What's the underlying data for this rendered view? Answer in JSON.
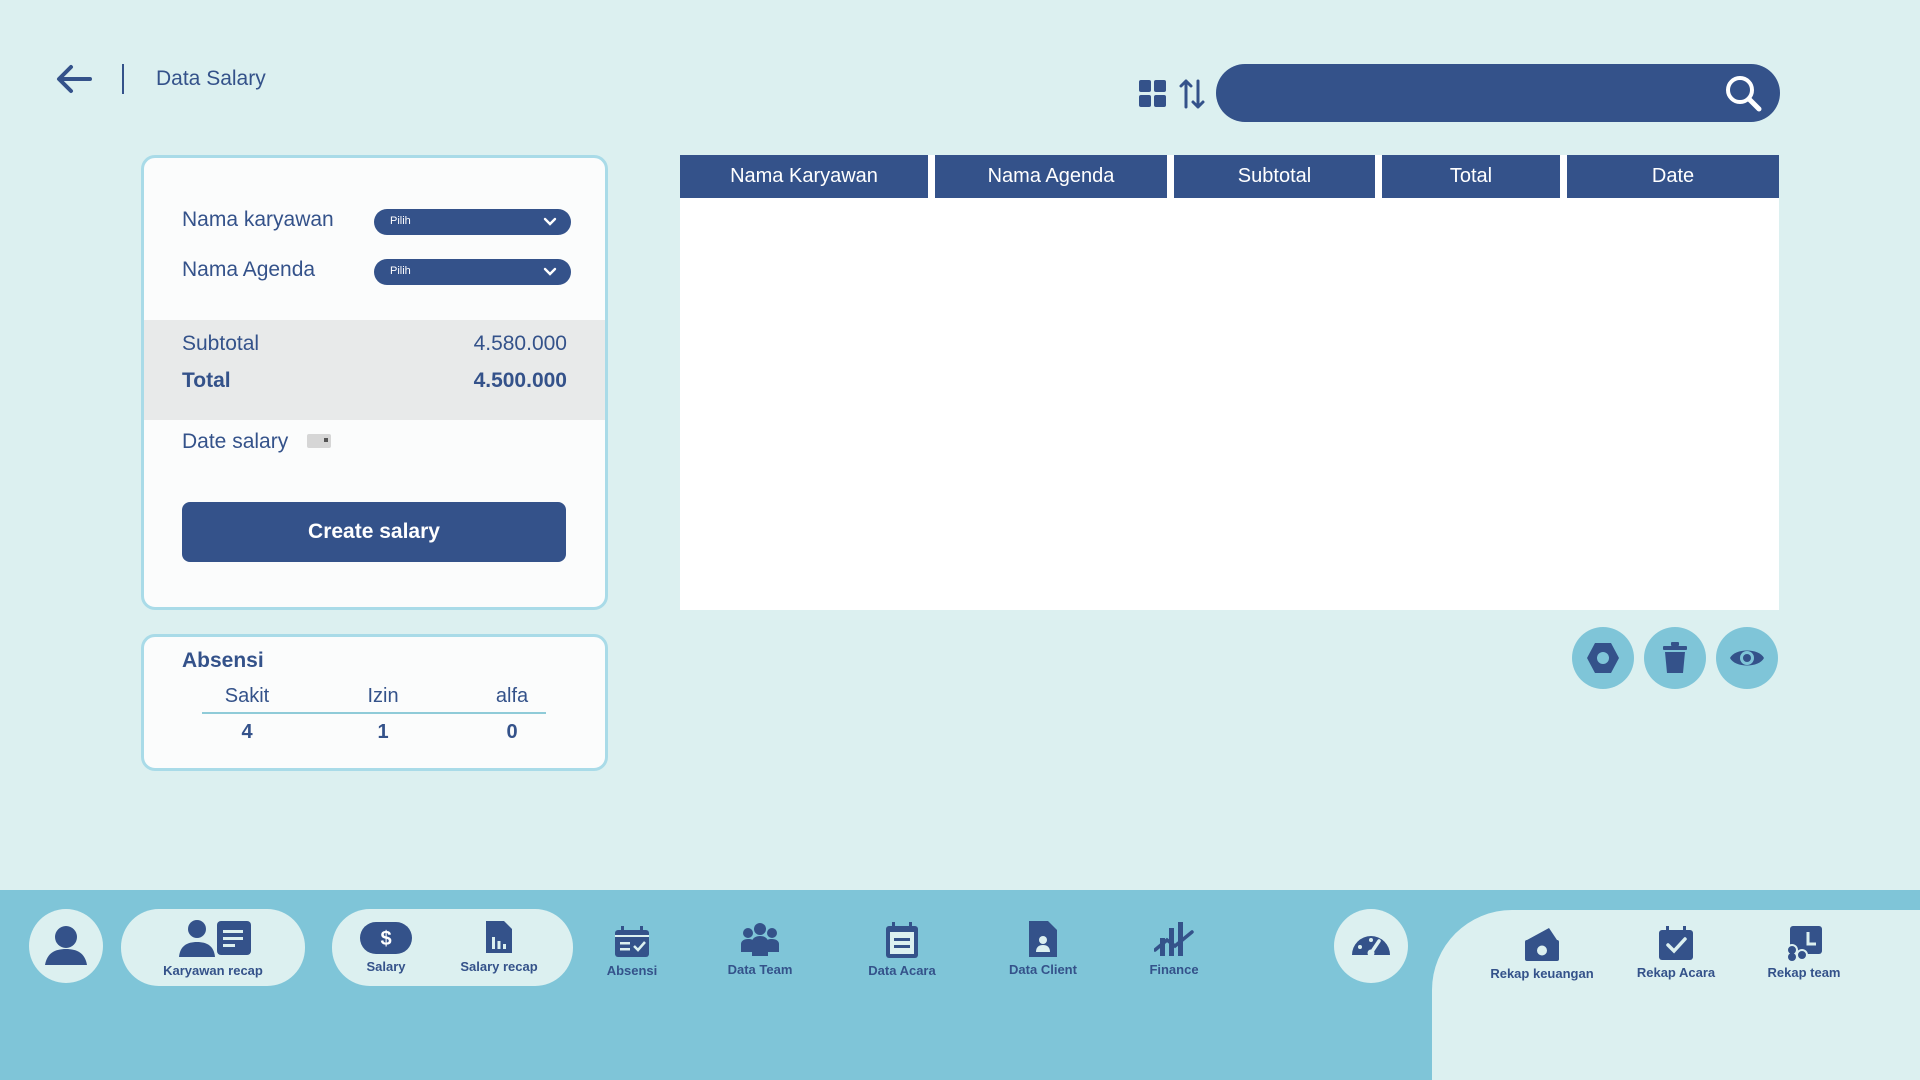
{
  "header": {
    "title": "Data Salary",
    "search_placeholder": ""
  },
  "form": {
    "employee_label": "Nama karyawan",
    "employee_select": "Pilih",
    "agenda_label": "Nama Agenda",
    "agenda_select": "Pilih",
    "subtotal_label": "Subtotal",
    "subtotal_value": "4.580.000",
    "total_label": "Total",
    "total_value": "4.500.000",
    "date_label": "Date salary",
    "create_button": "Create salary"
  },
  "absensi": {
    "title": "Absensi",
    "columns": [
      {
        "label": "Sakit",
        "value": "4"
      },
      {
        "label": "Izin",
        "value": "1"
      },
      {
        "label": "alfa",
        "value": "0"
      }
    ]
  },
  "table": {
    "headers": [
      "Nama Karyawan",
      "Nama Agenda",
      "Subtotal",
      "Total",
      "Date"
    ],
    "rows": []
  },
  "actions": [
    "edit-icon",
    "trash-icon",
    "eye-icon"
  ],
  "bottom_nav": {
    "karyawan_recap": "Karyawan recap",
    "salary": "Salary",
    "salary_recap": "Salary recap",
    "absensi": "Absensi",
    "data_team": "Data Team",
    "data_acara": "Data Acara",
    "data_client": "Data Client",
    "finance": "Finance",
    "rekap_keuangan": "Rekap keuangan",
    "rekap_acara": "Rekap Acara",
    "rekap_team": "Rekap team"
  },
  "colors": {
    "background": "#dcf0f0",
    "primary": "#34528a",
    "accent": "#7fc5d8",
    "card_border": "#a9dbe8"
  }
}
